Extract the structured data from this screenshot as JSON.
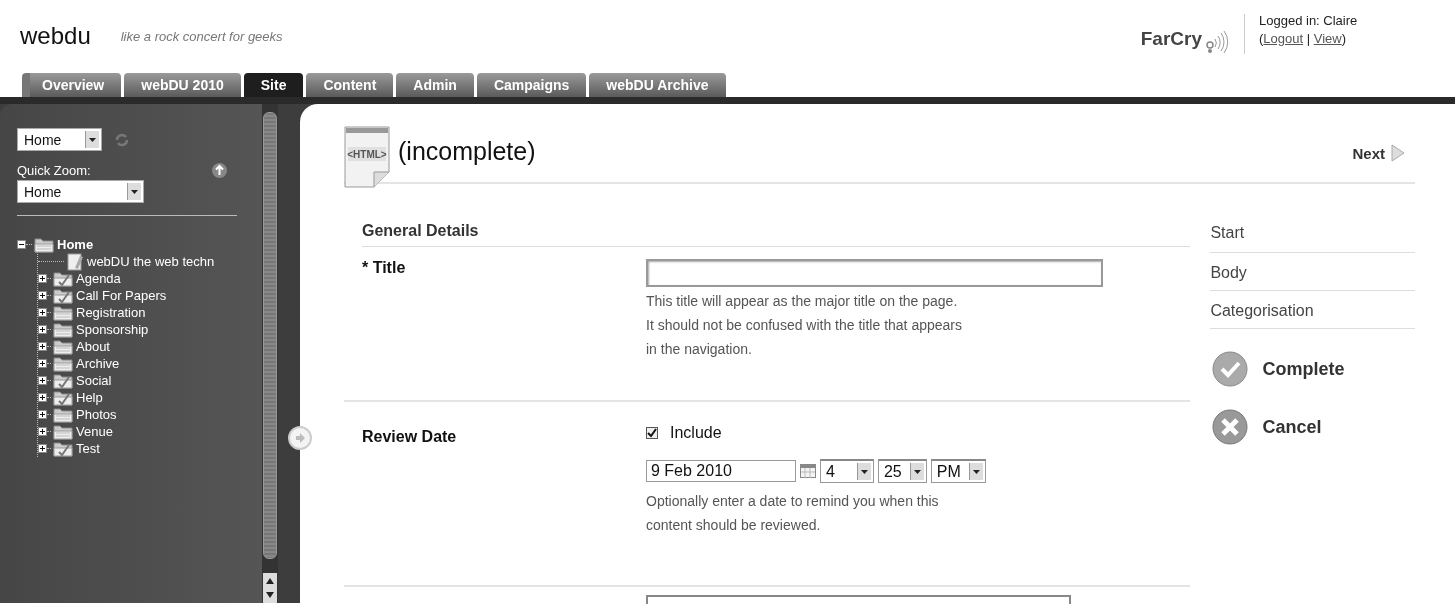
{
  "header": {
    "site_name": "webdu",
    "tagline": "like a rock concert for geeks",
    "logo_text": "FarCry",
    "logged_in": "Logged in: Claire",
    "account_links": [
      {
        "kind": "text",
        "text": "("
      },
      {
        "kind": "link",
        "text": "Logout"
      },
      {
        "kind": "text",
        "text": " | "
      },
      {
        "kind": "link",
        "text": "View"
      },
      {
        "kind": "text",
        "text": ")"
      }
    ]
  },
  "tabs": [
    {
      "label": "Overview",
      "selected": false
    },
    {
      "label": "webDU 2010",
      "selected": false
    },
    {
      "label": "Site",
      "selected": true
    },
    {
      "label": "Content",
      "selected": false
    },
    {
      "label": "Admin",
      "selected": false
    },
    {
      "label": "Campaigns",
      "selected": false
    },
    {
      "label": "webDU Archive",
      "selected": false
    }
  ],
  "sidebar": {
    "root_select": "Home",
    "quick_zoom_label": "Quick Zoom:",
    "quick_zoom_select": "Home",
    "tree": [
      {
        "label": "Home",
        "kind": "folder",
        "expanded": true,
        "children": [
          {
            "label": "webDU the web techn",
            "kind": "page"
          },
          {
            "label": "Agenda",
            "kind": "folder-check",
            "expanded": false
          },
          {
            "label": "Call For Papers",
            "kind": "folder-check",
            "expanded": false
          },
          {
            "label": "Registration",
            "kind": "folder",
            "expanded": false
          },
          {
            "label": "Sponsorship",
            "kind": "folder",
            "expanded": false
          },
          {
            "label": "About",
            "kind": "folder",
            "expanded": false
          },
          {
            "label": "Archive",
            "kind": "folder",
            "expanded": false
          },
          {
            "label": "Social",
            "kind": "folder-check",
            "expanded": false
          },
          {
            "label": "Help",
            "kind": "folder-check",
            "expanded": false
          },
          {
            "label": "Photos",
            "kind": "folder",
            "expanded": false
          },
          {
            "label": "Venue",
            "kind": "folder",
            "expanded": false
          },
          {
            "label": "Test",
            "kind": "folder-check",
            "expanded": false
          }
        ]
      }
    ]
  },
  "content": {
    "icon_label": "<HTML>",
    "title": "(incomplete)",
    "next": "Next",
    "section": "General Details",
    "fields": [
      {
        "kind": "text",
        "label": "* Title",
        "help": "This title will appear as the major title on the page. It should not be confused with the title that appears in the navigation."
      },
      {
        "kind": "date",
        "label": "Review Date",
        "include_label": "Include",
        "checked": true,
        "date": "9 Feb 2010",
        "hour": "4",
        "minute": "25",
        "ampm": "PM",
        "help": "Optionally enter a date to remind you when this content should be reviewed."
      },
      {
        "kind": "cut"
      }
    ],
    "steps": [
      "Start",
      "Body",
      "Categorisation"
    ],
    "actions": [
      {
        "kind": "complete",
        "label": "Complete"
      },
      {
        "kind": "cancel",
        "label": "Cancel"
      }
    ]
  }
}
